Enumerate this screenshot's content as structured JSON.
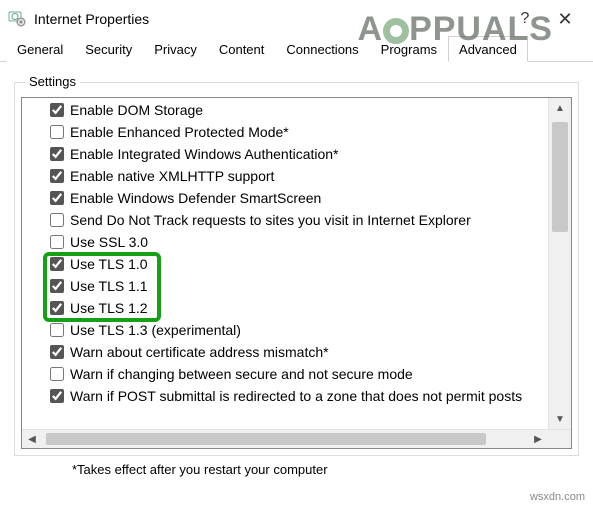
{
  "window": {
    "title": "Internet Properties",
    "help_symbol": "?",
    "close_symbol": "✕"
  },
  "tabs": [
    {
      "label": "General",
      "active": false
    },
    {
      "label": "Security",
      "active": false
    },
    {
      "label": "Privacy",
      "active": false
    },
    {
      "label": "Content",
      "active": false
    },
    {
      "label": "Connections",
      "active": false
    },
    {
      "label": "Programs",
      "active": false
    },
    {
      "label": "Advanced",
      "active": true
    }
  ],
  "settings": {
    "legend": "Settings",
    "items": [
      {
        "label": "Enable DOM Storage",
        "checked": true
      },
      {
        "label": "Enable Enhanced Protected Mode*",
        "checked": false
      },
      {
        "label": "Enable Integrated Windows Authentication*",
        "checked": true
      },
      {
        "label": "Enable native XMLHTTP support",
        "checked": true
      },
      {
        "label": "Enable Windows Defender SmartScreen",
        "checked": true
      },
      {
        "label": "Send Do Not Track requests to sites you visit in Internet Explorer",
        "checked": false
      },
      {
        "label": "Use SSL 3.0",
        "checked": false
      },
      {
        "label": "Use TLS 1.0",
        "checked": true,
        "highlight": true
      },
      {
        "label": "Use TLS 1.1",
        "checked": true,
        "highlight": true
      },
      {
        "label": "Use TLS 1.2",
        "checked": true,
        "highlight": true
      },
      {
        "label": "Use TLS 1.3 (experimental)",
        "checked": false
      },
      {
        "label": "Warn about certificate address mismatch*",
        "checked": true
      },
      {
        "label": "Warn if changing between secure and not secure mode",
        "checked": false
      },
      {
        "label": "Warn if POST submittal is redirected to a zone that does not permit posts",
        "checked": true
      }
    ]
  },
  "footnote": "*Takes effect after you restart your computer",
  "watermark": "wsxdn.com",
  "brand_text": "PPUALS"
}
